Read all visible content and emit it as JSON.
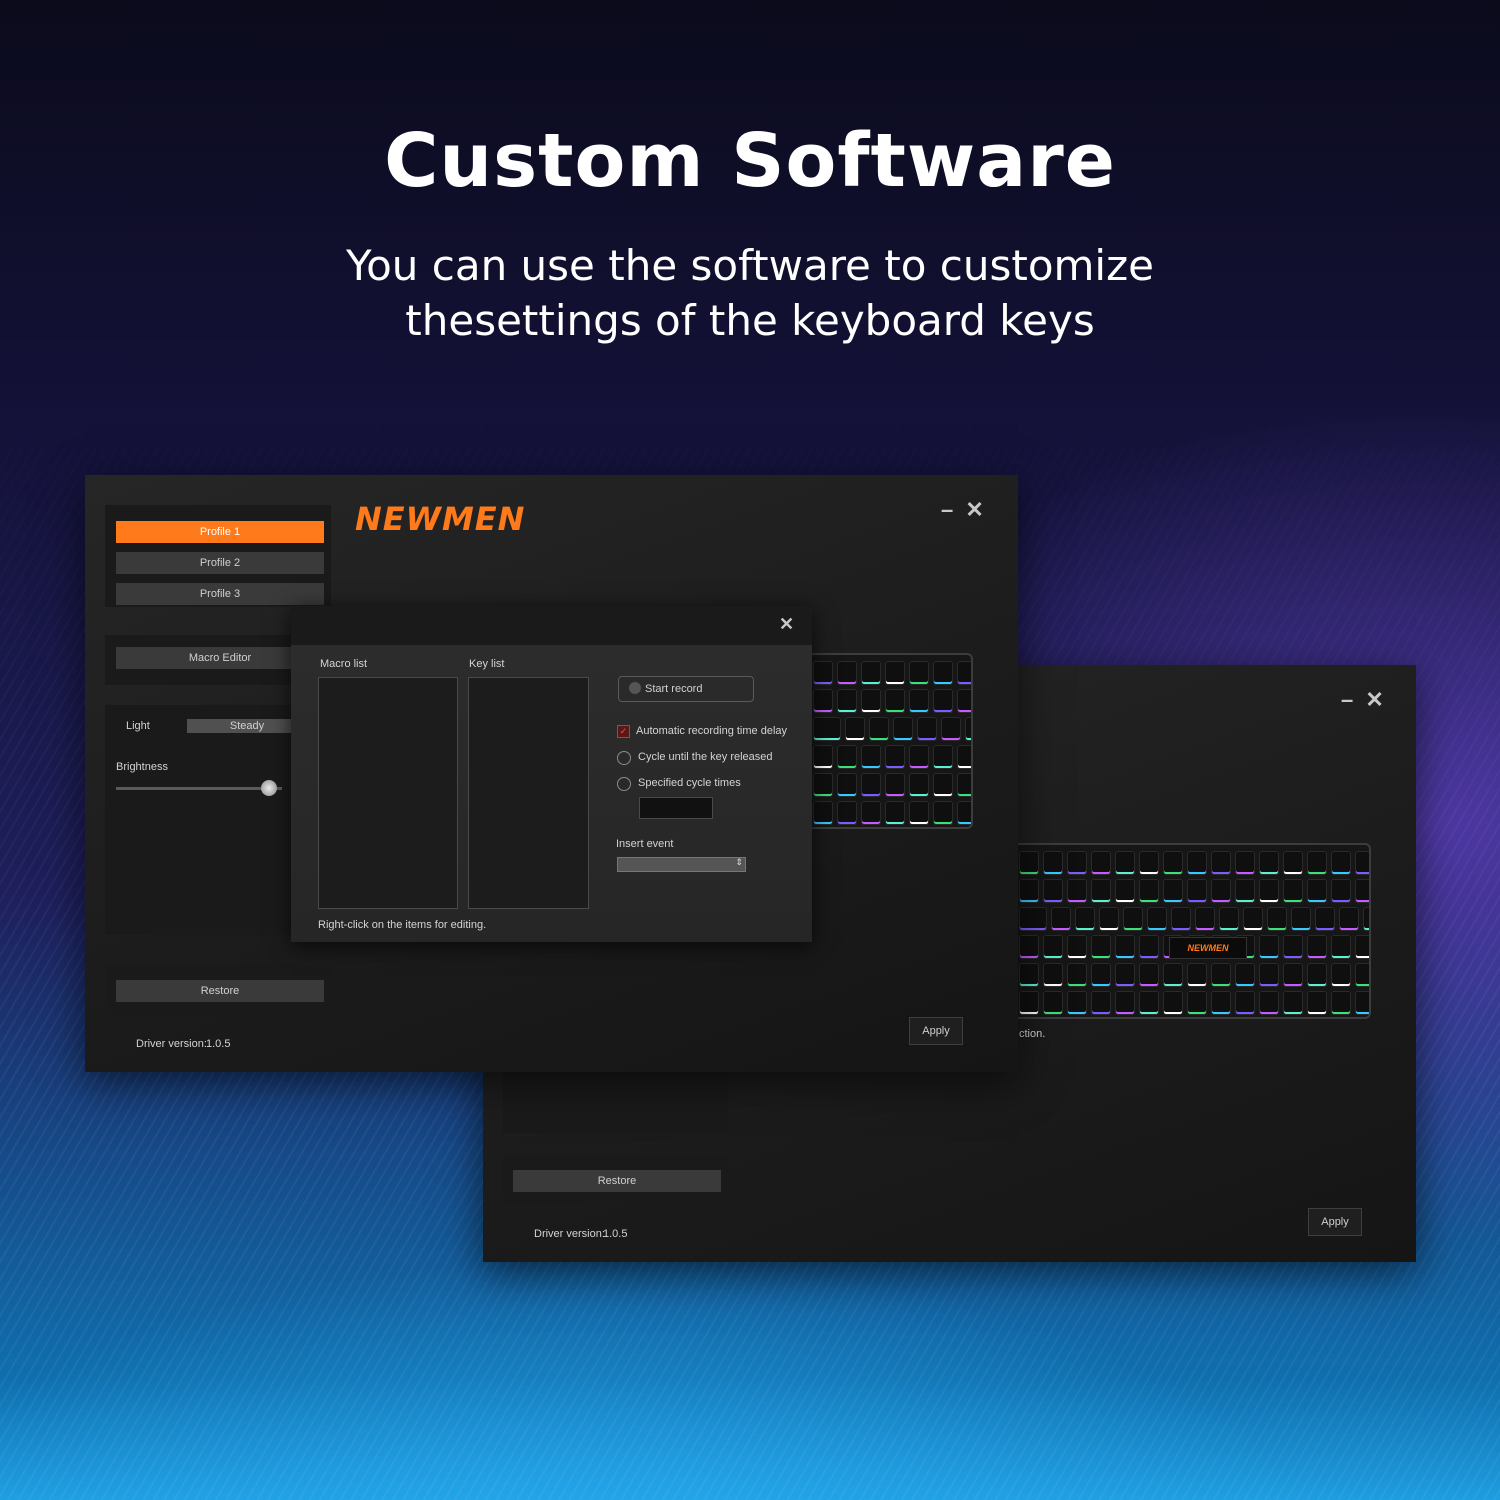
{
  "headline": "Custom Software",
  "subline_1": "You can use the software to customize",
  "subline_2": "thesettings of the keyboard keys",
  "front_window": {
    "logo": "NEWMEN",
    "profiles": [
      "Profile 1",
      "Profile 2",
      "Profile 3"
    ],
    "macro_editor": "Macro Editor",
    "light_label": "Light",
    "light_mode": "Steady",
    "brightness_label": "Brightness",
    "restore": "Restore",
    "driver_version_label": "Driver version:",
    "driver_version": "1.0.5",
    "apply": "Apply",
    "minimize": "–",
    "close": "✕"
  },
  "back_window": {
    "restore": "Restore",
    "driver_version_label": "Driver version:",
    "driver_version": "1.0.5",
    "apply": "Apply",
    "partial_text": "ction.",
    "keyboard_logo": "NEWMEN",
    "minimize": "–",
    "close": "✕"
  },
  "macro_dialog": {
    "close": "✕",
    "macro_list": "Macro list",
    "key_list": "Key list",
    "start_record": "Start record",
    "auto_delay": "Automatic recording time delay",
    "cycle_until_release": "Cycle until the key released",
    "specified_cycle": "Specified cycle times",
    "insert_event": "Insert event",
    "hint": "Right-click on the items for editing."
  },
  "colors": {
    "accent": "#ff7a1a",
    "window_bg": "#1e1e1e"
  },
  "brightness_level": 0.92
}
